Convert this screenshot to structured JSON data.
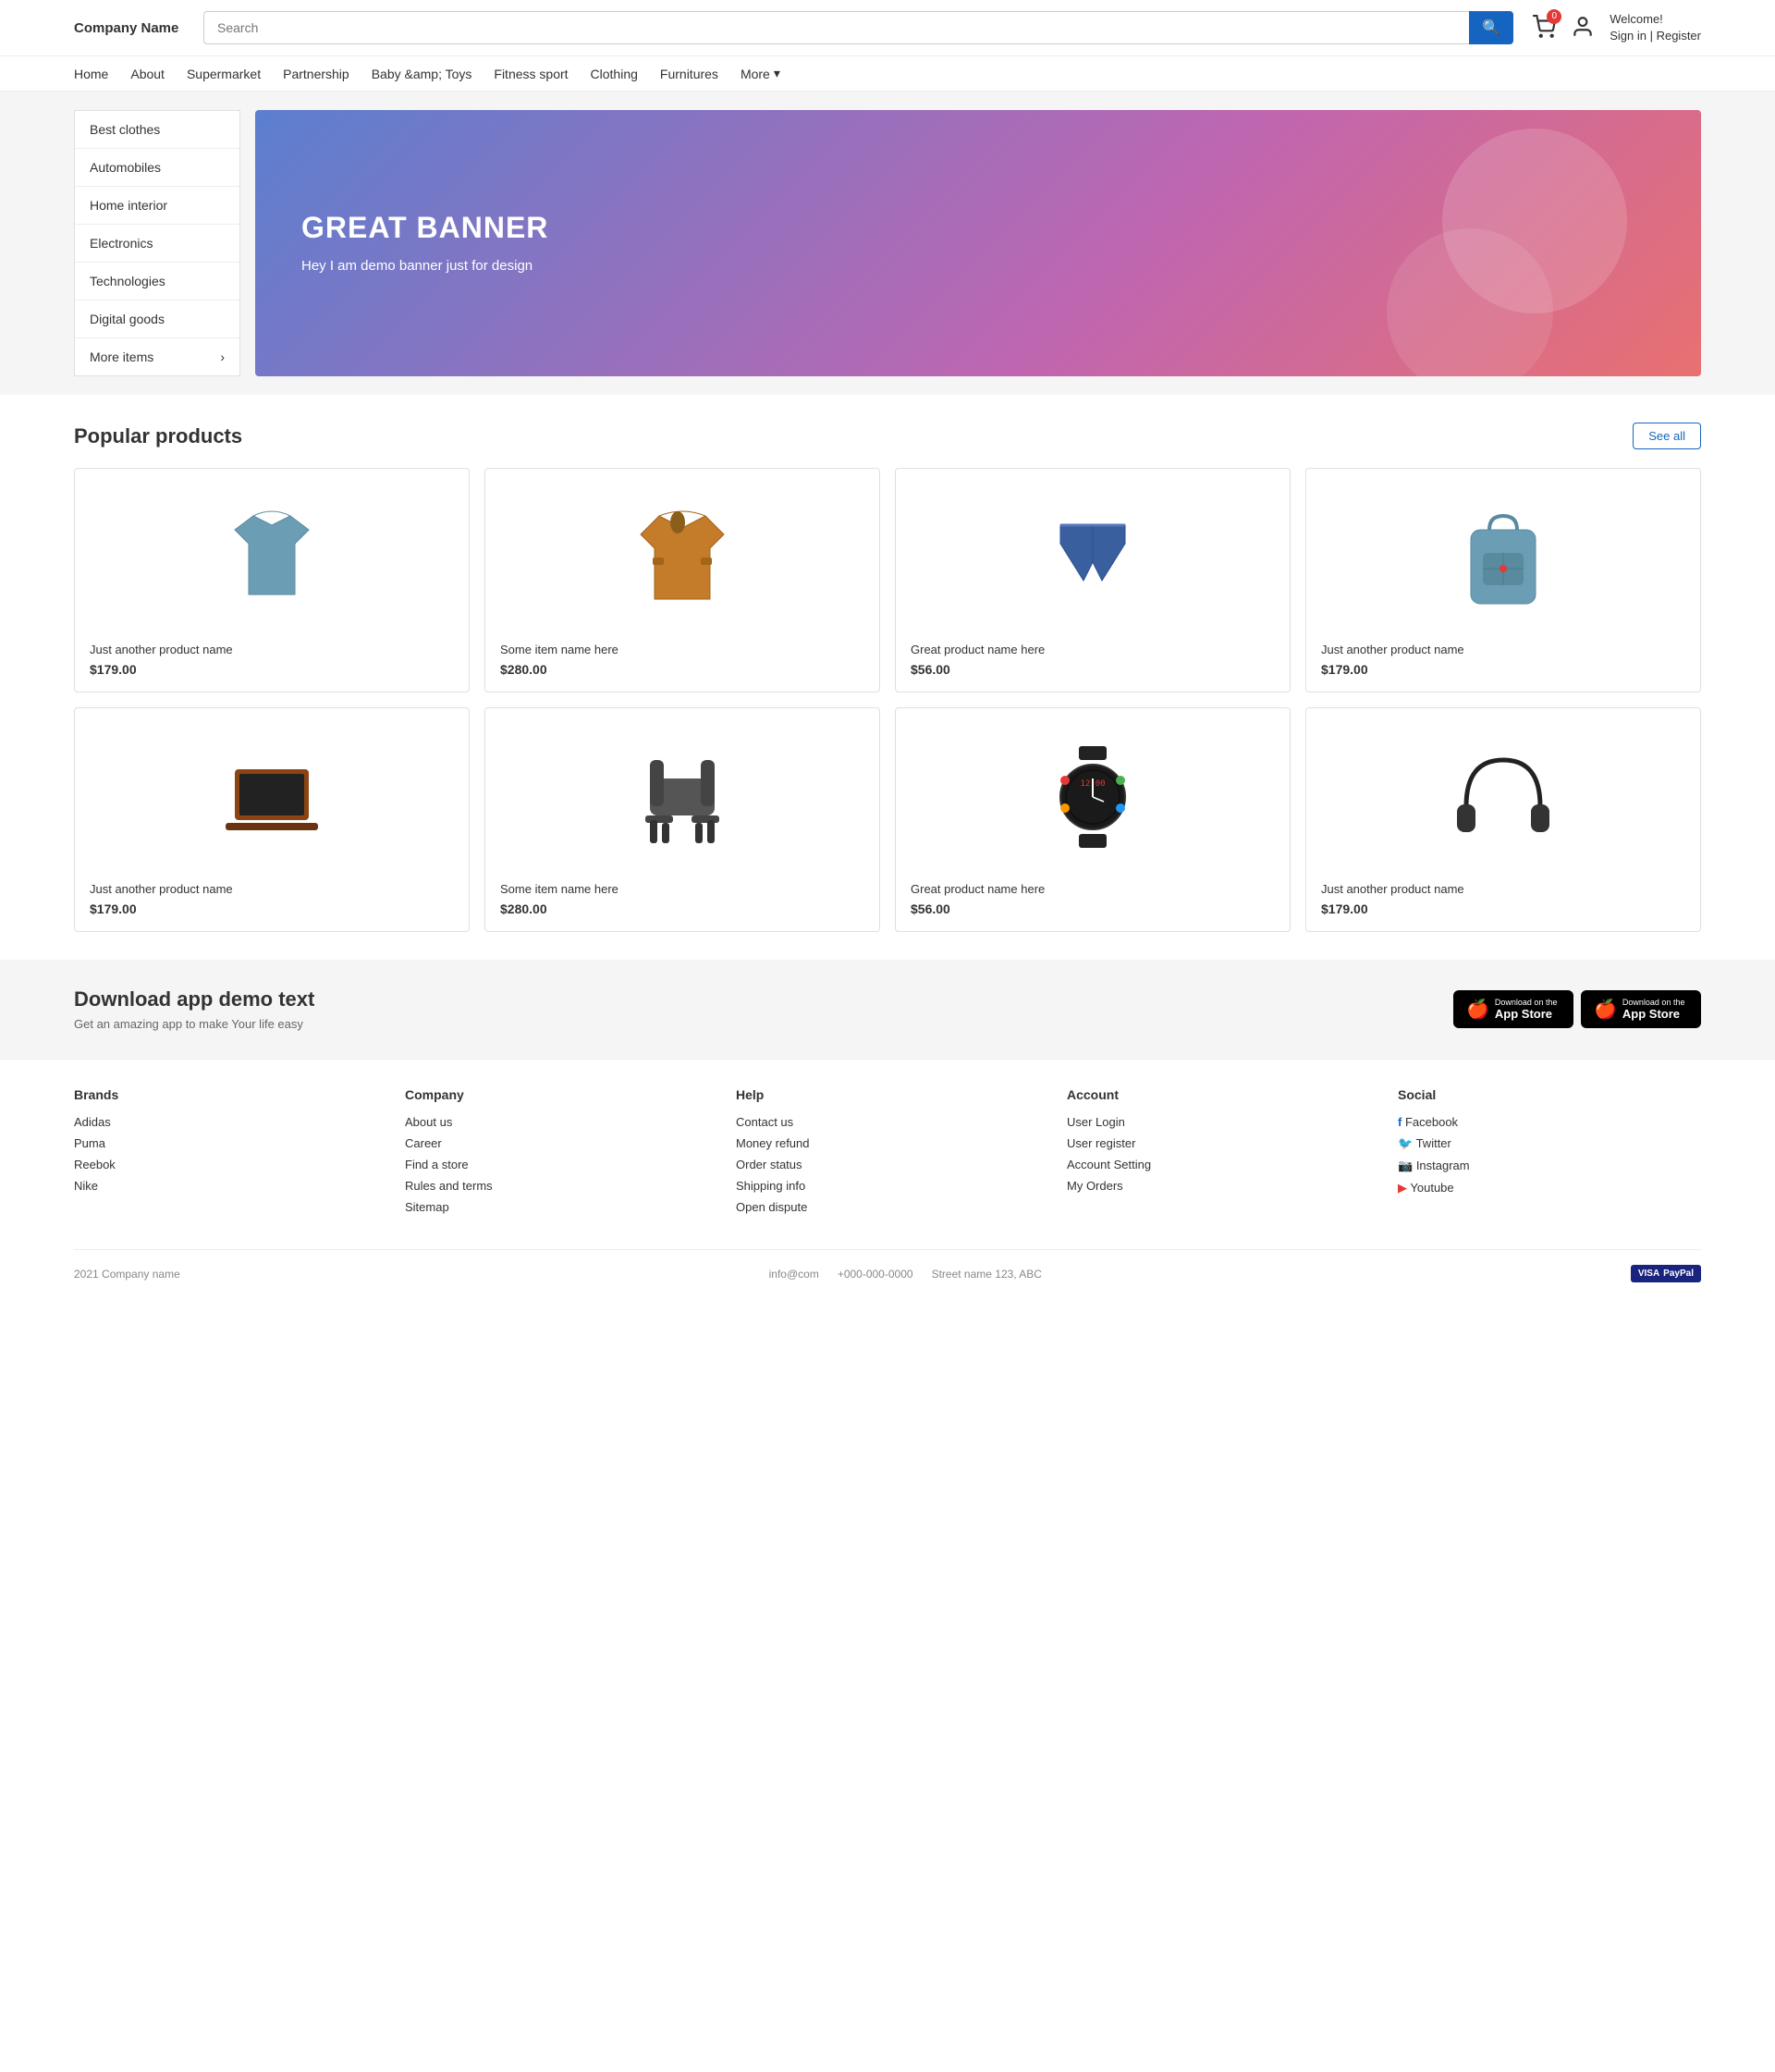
{
  "header": {
    "logo": "Company Name",
    "search_placeholder": "Search",
    "cart_count": "0",
    "welcome": "Welcome!",
    "sign_in": "Sign in | Register",
    "search_btn": "🔍"
  },
  "nav": {
    "items": [
      {
        "label": "Home"
      },
      {
        "label": "About"
      },
      {
        "label": "Supermarket"
      },
      {
        "label": "Partnership"
      },
      {
        "label": "Baby &amp; Toys"
      },
      {
        "label": "Fitness sport"
      },
      {
        "label": "Clothing"
      },
      {
        "label": "Furnitures"
      },
      {
        "label": "More"
      }
    ]
  },
  "sidebar": {
    "items": [
      {
        "label": "Best clothes"
      },
      {
        "label": "Automobiles"
      },
      {
        "label": "Home interior"
      },
      {
        "label": "Electronics"
      },
      {
        "label": "Technologies"
      },
      {
        "label": "Digital goods"
      },
      {
        "label": "More items",
        "has_arrow": true
      }
    ]
  },
  "banner": {
    "title": "GREAT BANNER",
    "subtitle": "Hey I am demo banner just for design"
  },
  "products_section": {
    "title": "Popular products",
    "see_all": "See all",
    "products": [
      {
        "name": "Just another product name",
        "price": "$179.00",
        "type": "shirt"
      },
      {
        "name": "Some item name here",
        "price": "$280.00",
        "type": "jacket"
      },
      {
        "name": "Great product name here",
        "price": "$56.00",
        "type": "shorts"
      },
      {
        "name": "Just another product name",
        "price": "$179.00",
        "type": "backpack"
      },
      {
        "name": "Just another product name",
        "price": "$179.00",
        "type": "laptop"
      },
      {
        "name": "Some item name here",
        "price": "$280.00",
        "type": "chair"
      },
      {
        "name": "Great product name here",
        "price": "$56.00",
        "type": "watch"
      },
      {
        "name": "Just another product name",
        "price": "$179.00",
        "type": "headphones"
      }
    ]
  },
  "download_section": {
    "title": "Download app demo text",
    "subtitle": "Get an amazing app to make Your life easy",
    "btn1_small": "Download on the",
    "btn1_big": "App Store",
    "btn2_small": "Download on the",
    "btn2_big": "App Store"
  },
  "footer": {
    "brands": {
      "heading": "Brands",
      "links": [
        "Adidas",
        "Puma",
        "Reebok",
        "Nike"
      ]
    },
    "company": {
      "heading": "Company",
      "links": [
        "About us",
        "Career",
        "Find a store",
        "Rules and terms",
        "Sitemap"
      ]
    },
    "help": {
      "heading": "Help",
      "links": [
        "Contact us",
        "Money refund",
        "Order status",
        "Shipping info",
        "Open dispute"
      ]
    },
    "account": {
      "heading": "Account",
      "links": [
        "User Login",
        "User register",
        "Account Setting",
        "My Orders"
      ]
    },
    "social": {
      "heading": "Social",
      "links": [
        {
          "label": "Facebook",
          "icon": "fb"
        },
        {
          "label": "Twitter",
          "icon": "tw"
        },
        {
          "label": "Instagram",
          "icon": "ig"
        },
        {
          "label": "Youtube",
          "icon": "yt"
        }
      ]
    },
    "bottom": {
      "copyright": "2021 Company name",
      "email": "info@com",
      "phone": "+000-000-0000",
      "address": "Street name 123, ABC"
    }
  }
}
